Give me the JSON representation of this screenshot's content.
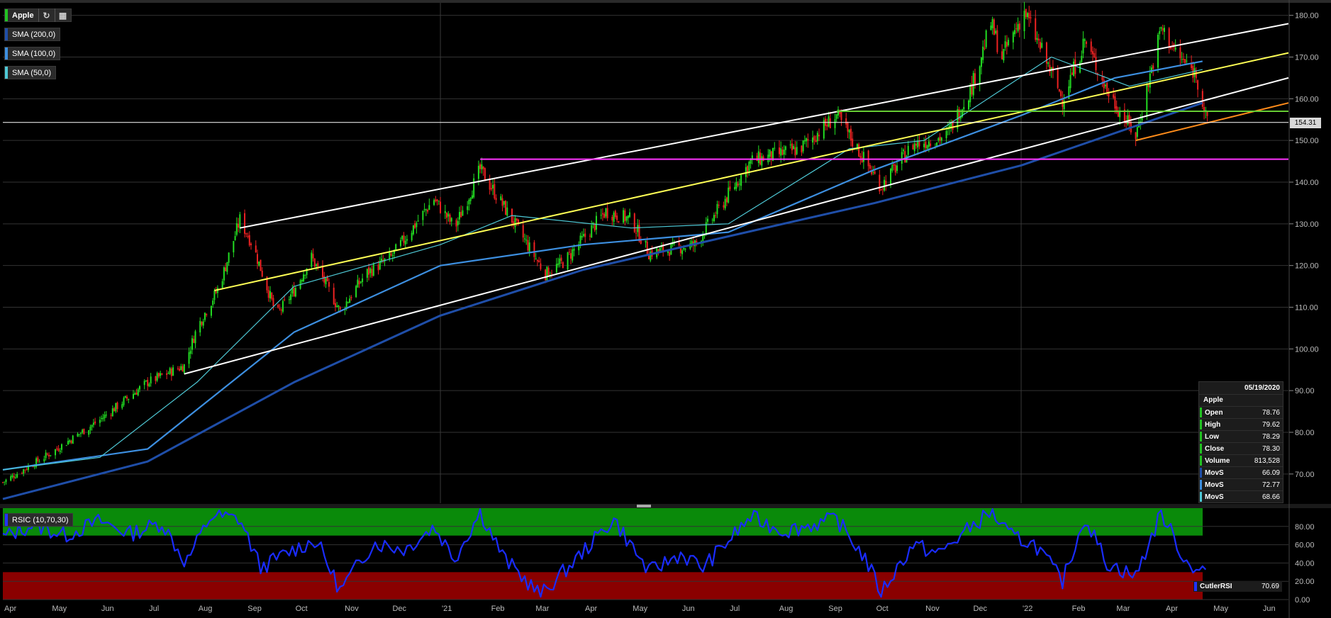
{
  "title": "Apple",
  "indicators": [
    {
      "label": "SMA (200,0)",
      "color": "#1f4ea8"
    },
    {
      "label": "SMA (100,0)",
      "color": "#3d8fe0"
    },
    {
      "label": "SMA (50,0)",
      "color": "#4ec9d6"
    }
  ],
  "rsi_label": "RSIC (10,70,30)",
  "price_tag": "154.31",
  "info_panel": {
    "date": "05/19/2020",
    "symbol": "Apple",
    "rows": [
      {
        "label": "Open",
        "value": "78.76",
        "color": "#22c322"
      },
      {
        "label": "High",
        "value": "79.62",
        "color": "#22c322"
      },
      {
        "label": "Low",
        "value": "78.29",
        "color": "#22c322"
      },
      {
        "label": "Close",
        "value": "78.30",
        "color": "#22c322"
      },
      {
        "label": "Volume",
        "value": "813,528",
        "color": "#22c322"
      },
      {
        "label": "MovS",
        "value": "66.09",
        "color": "#1f4ea8"
      },
      {
        "label": "MovS",
        "value": "72.77",
        "color": "#3d8fe0"
      },
      {
        "label": "MovS",
        "value": "68.66",
        "color": "#4ec9d6"
      }
    ]
  },
  "rsi_panel": {
    "label": "CutlerRSI",
    "value": "70.69"
  },
  "colors": {
    "up": "#22dd22",
    "down": "#ee2222",
    "background": "#000000",
    "grid": "#333333"
  },
  "chart_data": {
    "type": "candlestick",
    "price_axis": {
      "ylim": [
        63,
        183
      ],
      "ticks": [
        "70.00",
        "80.00",
        "90.00",
        "100.00",
        "110.00",
        "120.00",
        "130.00",
        "140.00",
        "150.00",
        "160.00",
        "170.00",
        "180.00"
      ]
    },
    "time_axis": {
      "range": [
        "2020-04-01",
        "2022-06-18"
      ],
      "labels": [
        {
          "label": "Apr",
          "date": "2020-04-01"
        },
        {
          "label": "May",
          "date": "2020-05-01"
        },
        {
          "label": "Jun",
          "date": "2020-06-01"
        },
        {
          "label": "Jul",
          "date": "2020-07-01"
        },
        {
          "label": "Aug",
          "date": "2020-08-01"
        },
        {
          "label": "Sep",
          "date": "2020-09-01"
        },
        {
          "label": "Oct",
          "date": "2020-10-01"
        },
        {
          "label": "Nov",
          "date": "2020-11-01"
        },
        {
          "label": "Dec",
          "date": "2020-12-01"
        },
        {
          "label": "'21",
          "date": "2021-01-01"
        },
        {
          "label": "Feb",
          "date": "2021-02-01"
        },
        {
          "label": "Mar",
          "date": "2021-03-01"
        },
        {
          "label": "Apr",
          "date": "2021-04-01"
        },
        {
          "label": "May",
          "date": "2021-05-01"
        },
        {
          "label": "Jun",
          "date": "2021-06-01"
        },
        {
          "label": "Jul",
          "date": "2021-07-01"
        },
        {
          "label": "Aug",
          "date": "2021-08-01"
        },
        {
          "label": "Sep",
          "date": "2021-09-01"
        },
        {
          "label": "Oct",
          "date": "2021-10-01"
        },
        {
          "label": "Nov",
          "date": "2021-11-01"
        },
        {
          "label": "Dec",
          "date": "2021-12-01"
        },
        {
          "label": "'22",
          "date": "2022-01-01"
        },
        {
          "label": "Feb",
          "date": "2022-02-01"
        },
        {
          "label": "Mar",
          "date": "2022-03-01"
        },
        {
          "label": "Apr",
          "date": "2022-04-01"
        },
        {
          "label": "May",
          "date": "2022-05-01"
        },
        {
          "label": "Jun",
          "date": "2022-06-01"
        }
      ]
    },
    "price_path": [
      {
        "date": "2020-04-01",
        "close": 68
      },
      {
        "date": "2020-05-01",
        "close": 75
      },
      {
        "date": "2020-06-01",
        "close": 83
      },
      {
        "date": "2020-07-01",
        "close": 92
      },
      {
        "date": "2020-07-24",
        "close": 96
      },
      {
        "date": "2020-08-01",
        "close": 105
      },
      {
        "date": "2020-08-15",
        "close": 115
      },
      {
        "date": "2020-08-28",
        "close": 131
      },
      {
        "date": "2020-09-05",
        "close": 125
      },
      {
        "date": "2020-09-20",
        "close": 108
      },
      {
        "date": "2020-10-01",
        "close": 114
      },
      {
        "date": "2020-10-12",
        "close": 122
      },
      {
        "date": "2020-10-30",
        "close": 109
      },
      {
        "date": "2020-11-15",
        "close": 118
      },
      {
        "date": "2020-12-01",
        "close": 122
      },
      {
        "date": "2020-12-28",
        "close": 136
      },
      {
        "date": "2021-01-10",
        "close": 129
      },
      {
        "date": "2021-01-26",
        "close": 143
      },
      {
        "date": "2021-02-15",
        "close": 131
      },
      {
        "date": "2021-03-08",
        "close": 118
      },
      {
        "date": "2021-03-20",
        "close": 121
      },
      {
        "date": "2021-04-15",
        "close": 133
      },
      {
        "date": "2021-05-01",
        "close": 131
      },
      {
        "date": "2021-05-12",
        "close": 123
      },
      {
        "date": "2021-06-10",
        "close": 125
      },
      {
        "date": "2021-07-15",
        "close": 145
      },
      {
        "date": "2021-08-15",
        "close": 148
      },
      {
        "date": "2021-09-07",
        "close": 156
      },
      {
        "date": "2021-09-25",
        "close": 145
      },
      {
        "date": "2021-10-05",
        "close": 139
      },
      {
        "date": "2021-10-25",
        "close": 149
      },
      {
        "date": "2021-11-15",
        "close": 151
      },
      {
        "date": "2021-12-01",
        "close": 163
      },
      {
        "date": "2021-12-13",
        "close": 178
      },
      {
        "date": "2021-12-20",
        "close": 170
      },
      {
        "date": "2022-01-03",
        "close": 181
      },
      {
        "date": "2022-01-27",
        "close": 160
      },
      {
        "date": "2022-02-10",
        "close": 174
      },
      {
        "date": "2022-02-24",
        "close": 162
      },
      {
        "date": "2022-03-14",
        "close": 151
      },
      {
        "date": "2022-03-30",
        "close": 177
      },
      {
        "date": "2022-04-10",
        "close": 170
      },
      {
        "date": "2022-04-21",
        "close": 166
      },
      {
        "date": "2022-04-28",
        "close": 154
      }
    ],
    "moving_averages": [
      {
        "name": "SMA (200,0)",
        "color": "#1f4ea8",
        "points": [
          {
            "date": "2020-04-01",
            "value": 64
          },
          {
            "date": "2020-07-01",
            "value": 73
          },
          {
            "date": "2020-10-01",
            "value": 92
          },
          {
            "date": "2021-01-01",
            "value": 108
          },
          {
            "date": "2021-04-01",
            "value": 119
          },
          {
            "date": "2021-07-01",
            "value": 127
          },
          {
            "date": "2021-10-01",
            "value": 135
          },
          {
            "date": "2022-01-01",
            "value": 144
          },
          {
            "date": "2022-04-25",
            "value": 159
          }
        ]
      },
      {
        "name": "SMA (100,0)",
        "color": "#3d8fe0",
        "points": [
          {
            "date": "2020-04-01",
            "value": 71
          },
          {
            "date": "2020-07-01",
            "value": 76
          },
          {
            "date": "2020-10-01",
            "value": 104
          },
          {
            "date": "2021-01-01",
            "value": 120
          },
          {
            "date": "2021-04-01",
            "value": 125
          },
          {
            "date": "2021-07-01",
            "value": 128
          },
          {
            "date": "2021-10-01",
            "value": 143
          },
          {
            "date": "2022-01-01",
            "value": 156
          },
          {
            "date": "2022-03-01",
            "value": 165
          },
          {
            "date": "2022-04-25",
            "value": 169
          }
        ]
      },
      {
        "name": "SMA (50,0)",
        "color": "#4ec9d6",
        "points": [
          {
            "date": "2020-04-01",
            "value": 71
          },
          {
            "date": "2020-06-01",
            "value": 74
          },
          {
            "date": "2020-08-01",
            "value": 92
          },
          {
            "date": "2020-10-01",
            "value": 115
          },
          {
            "date": "2021-01-01",
            "value": 125
          },
          {
            "date": "2021-02-15",
            "value": 132
          },
          {
            "date": "2021-05-01",
            "value": 129
          },
          {
            "date": "2021-07-01",
            "value": 130
          },
          {
            "date": "2021-09-15",
            "value": 148
          },
          {
            "date": "2021-11-01",
            "value": 150
          },
          {
            "date": "2022-01-20",
            "value": 170
          },
          {
            "date": "2022-03-10",
            "value": 163
          },
          {
            "date": "2022-04-25",
            "value": 167
          }
        ]
      }
    ],
    "trendlines": [
      {
        "color": "#ffffff",
        "from": {
          "date": "2020-08-28",
          "value": 129
        },
        "to": {
          "date": "2022-06-18",
          "value": 178
        }
      },
      {
        "color": "#ffffff",
        "from": {
          "date": "2020-07-24",
          "value": 94
        },
        "to": {
          "date": "2022-06-18",
          "value": 165
        }
      },
      {
        "color": "#ffff55",
        "from": {
          "date": "2020-08-12",
          "value": 114
        },
        "to": {
          "date": "2022-06-18",
          "value": 171
        }
      },
      {
        "color": "#ff8c1a",
        "from": {
          "date": "2022-03-14",
          "value": 150
        },
        "to": {
          "date": "2022-06-18",
          "value": 159
        }
      },
      {
        "color": "#ff33ff",
        "from": {
          "date": "2021-01-26",
          "value": 145.5
        },
        "to": {
          "date": "2022-06-18",
          "value": 145.5
        }
      },
      {
        "color": "#66cc33",
        "from": {
          "date": "2021-09-07",
          "value": 157
        },
        "to": {
          "date": "2022-06-18",
          "value": 157
        }
      },
      {
        "color": "#ffffff",
        "from": {
          "date": "2020-04-01",
          "value": 154.31
        },
        "to": {
          "date": "2022-06-18",
          "value": 154.31
        }
      }
    ],
    "rsi": {
      "ylim": [
        0,
        100
      ],
      "ticks": [
        "0.00",
        "20.00",
        "40.00",
        "60.00",
        "80.00"
      ],
      "overbought": 70,
      "oversold": 30,
      "points": [
        {
          "date": "2020-04-01",
          "value": 68
        },
        {
          "date": "2020-04-20",
          "value": 82
        },
        {
          "date": "2020-05-10",
          "value": 70
        },
        {
          "date": "2020-06-01",
          "value": 86
        },
        {
          "date": "2020-06-20",
          "value": 72
        },
        {
          "date": "2020-07-10",
          "value": 84
        },
        {
          "date": "2020-07-25",
          "value": 40
        },
        {
          "date": "2020-08-10",
          "value": 92
        },
        {
          "date": "2020-08-28",
          "value": 88
        },
        {
          "date": "2020-09-10",
          "value": 35
        },
        {
          "date": "2020-10-01",
          "value": 55
        },
        {
          "date": "2020-10-15",
          "value": 65
        },
        {
          "date": "2020-10-30",
          "value": 10
        },
        {
          "date": "2020-11-20",
          "value": 62
        },
        {
          "date": "2020-12-10",
          "value": 55
        },
        {
          "date": "2020-12-28",
          "value": 80
        },
        {
          "date": "2021-01-10",
          "value": 45
        },
        {
          "date": "2021-01-26",
          "value": 96
        },
        {
          "date": "2021-02-10",
          "value": 45
        },
        {
          "date": "2021-03-05",
          "value": 5
        },
        {
          "date": "2021-03-25",
          "value": 40
        },
        {
          "date": "2021-04-20",
          "value": 88
        },
        {
          "date": "2021-05-12",
          "value": 30
        },
        {
          "date": "2021-06-01",
          "value": 50
        },
        {
          "date": "2021-06-15",
          "value": 35
        },
        {
          "date": "2021-07-15",
          "value": 90
        },
        {
          "date": "2021-08-05",
          "value": 75
        },
        {
          "date": "2021-09-07",
          "value": 88
        },
        {
          "date": "2021-09-25",
          "value": 45
        },
        {
          "date": "2021-10-05",
          "value": 8
        },
        {
          "date": "2021-10-25",
          "value": 60
        },
        {
          "date": "2021-11-10",
          "value": 50
        },
        {
          "date": "2021-12-01",
          "value": 80
        },
        {
          "date": "2021-12-13",
          "value": 96
        },
        {
          "date": "2021-12-25",
          "value": 70
        },
        {
          "date": "2022-01-10",
          "value": 60
        },
        {
          "date": "2022-01-27",
          "value": 20
        },
        {
          "date": "2022-02-10",
          "value": 90
        },
        {
          "date": "2022-02-24",
          "value": 40
        },
        {
          "date": "2022-03-14",
          "value": 25
        },
        {
          "date": "2022-03-30",
          "value": 95
        },
        {
          "date": "2022-04-15",
          "value": 40
        },
        {
          "date": "2022-04-28",
          "value": 30
        }
      ]
    }
  }
}
